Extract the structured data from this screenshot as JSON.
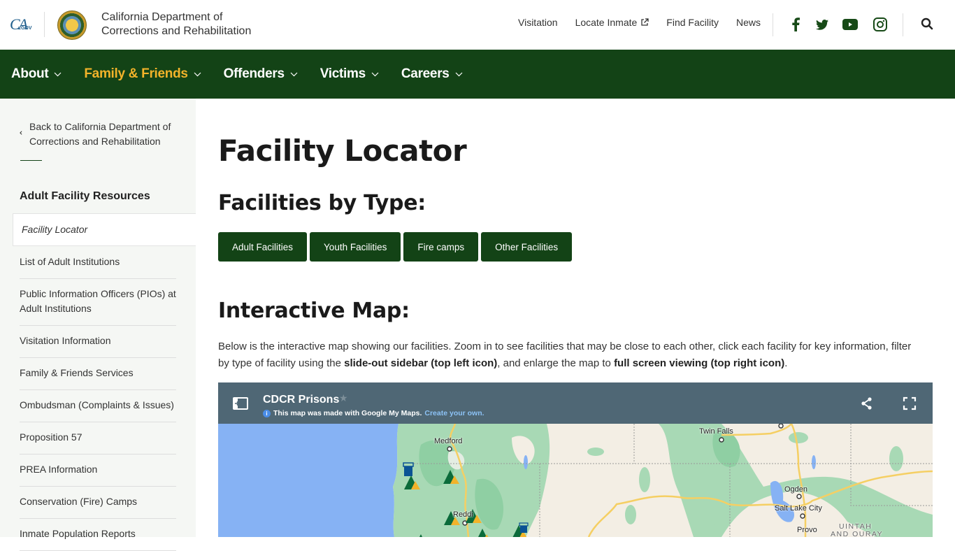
{
  "header": {
    "ca_logo": {
      "main": "CA",
      "suffix": ".GOV"
    },
    "org_name_line1": "California Department of",
    "org_name_line2": "Corrections and Rehabilitation",
    "top_links": [
      {
        "label": "Visitation",
        "external": false
      },
      {
        "label": "Locate Inmate",
        "external": true
      },
      {
        "label": "Find Facility",
        "external": false
      },
      {
        "label": "News",
        "external": false
      }
    ],
    "social": [
      "facebook-icon",
      "twitter-icon",
      "youtube-icon",
      "instagram-icon"
    ],
    "search_icon": "search-icon"
  },
  "nav": {
    "items": [
      {
        "label": "About",
        "active": false
      },
      {
        "label": "Family & Friends",
        "active": true
      },
      {
        "label": "Offenders",
        "active": false
      },
      {
        "label": "Victims",
        "active": false
      },
      {
        "label": "Careers",
        "active": false
      }
    ]
  },
  "sidebar": {
    "back_link": "Back to California Department of Corrections and Rehabilitation",
    "heading": "Adult Facility Resources",
    "active_item": "Facility Locator",
    "items": [
      "List of Adult Institutions",
      "Public Information Officers (PIOs) at Adult Institutions",
      "Visitation Information",
      "Family & Friends Services",
      "Ombudsman (Complaints & Issues)",
      "Proposition 57",
      "PREA Information",
      "Conservation (Fire) Camps",
      "Inmate Population Reports"
    ]
  },
  "main": {
    "title": "Facility Locator",
    "types_heading": "Facilities by Type:",
    "type_buttons": [
      "Adult Facilities",
      "Youth Facilities",
      "Fire camps",
      "Other Facilities"
    ],
    "map_heading": "Interactive Map:",
    "description": {
      "part1": "Below is the interactive map showing our facilities. Zoom in to see facilities that may be close to each other, click each facility for key information, filter by type of facility using the ",
      "bold1": "slide-out sidebar (top left icon)",
      "part2": ", and enlarge the map to ",
      "bold2": "full screen viewing (top right icon)",
      "part3": "."
    }
  },
  "map": {
    "title": "CDCR Prisons",
    "made_with": "This map was made with Google My Maps.",
    "create_link": "Create your own.",
    "cities": [
      "Medford",
      "Reddi",
      "Twin Falls",
      "Ogden",
      "Salt Lake City",
      "Provo",
      "UINTAH",
      "AND OURAY"
    ]
  },
  "colors": {
    "brand_green": "#134316",
    "nav_active": "#f2b32a",
    "map_bar": "#4f6775",
    "water": "#86b2f4",
    "land": "#f3eee4",
    "forest": "#a8d9b5"
  }
}
